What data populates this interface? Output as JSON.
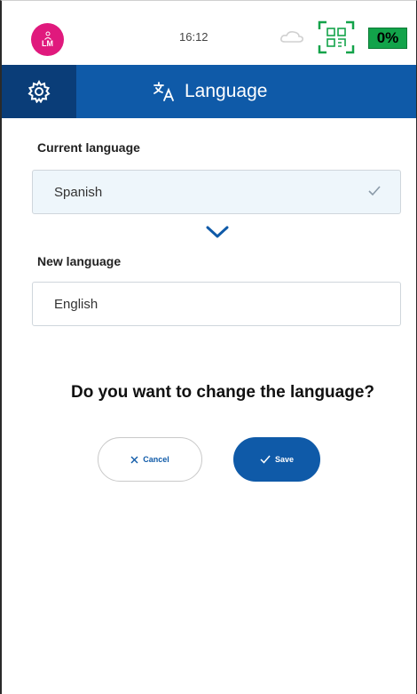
{
  "status_bar": {
    "avatar_initials": "LM",
    "time": "16:12",
    "battery": "0%",
    "battery_color": "#12a34a",
    "avatar_color": "#e0197d",
    "icons": [
      "person-icon",
      "cloud-icon",
      "qr-code-icon"
    ]
  },
  "header": {
    "title": "Language",
    "settings_icon": "gear-icon",
    "title_icon": "translate-icon",
    "background": "#0f5aa8",
    "settings_background": "#0a3d78"
  },
  "current_language": {
    "label": "Current language",
    "value": "Spanish",
    "icon": "check-icon"
  },
  "arrow_icon": "chevron-down-icon",
  "new_language": {
    "label": "New language",
    "value": "English"
  },
  "prompt": "Do you want to change the language?",
  "actions": {
    "cancel_label": "Cancel",
    "cancel_icon": "close-icon",
    "save_label": "Save",
    "save_icon": "check-icon"
  }
}
